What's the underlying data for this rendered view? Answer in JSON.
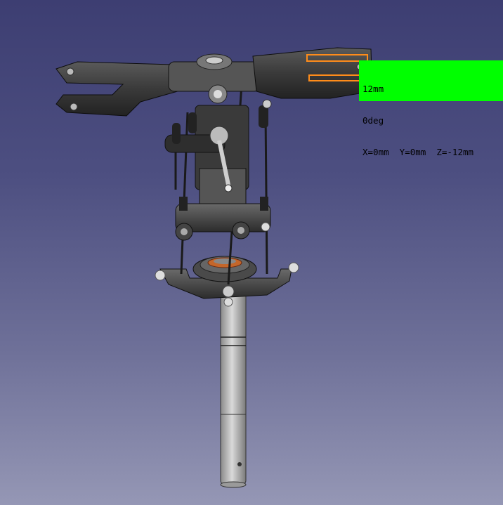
{
  "viewer": {
    "background_top": "#3d3e72",
    "background_bottom": "#9597b5"
  },
  "model": {
    "name": "helicopter-rotor-head-assembly"
  },
  "measurement": {
    "distance": "12mm",
    "angle": "0deg",
    "offset": "X=0mm  Y=0mm  Z=-12mm",
    "box_color": "#00ff00",
    "highlight_color": "#ff8c1a"
  }
}
